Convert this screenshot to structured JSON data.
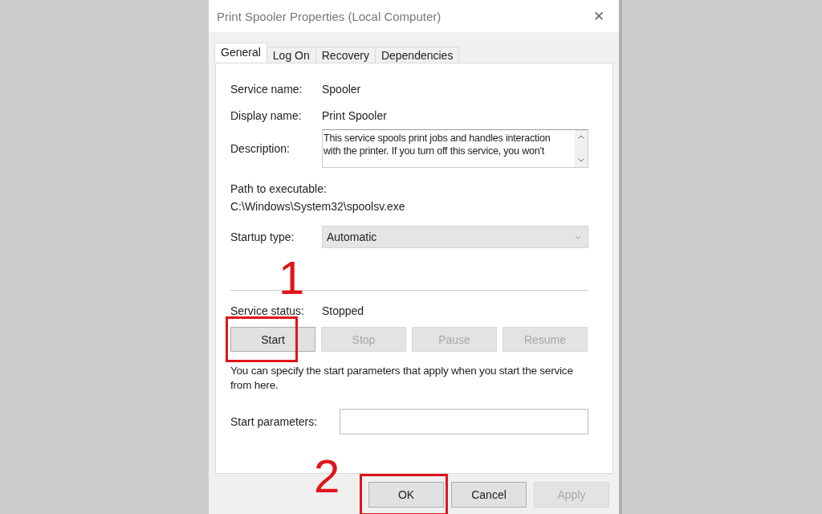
{
  "window": {
    "title": "Print Spooler Properties (Local Computer)",
    "close": "✕"
  },
  "tabs": [
    {
      "label": "General",
      "selected": true
    },
    {
      "label": "Log On",
      "selected": false
    },
    {
      "label": "Recovery",
      "selected": false
    },
    {
      "label": "Dependencies",
      "selected": false
    }
  ],
  "service_name": {
    "label": "Service name:",
    "value": "Spooler"
  },
  "display_name": {
    "label": "Display name:",
    "value": "Print Spooler"
  },
  "description": {
    "label": "Description:",
    "lines": [
      "This service spools print jobs and handles interaction",
      "with the printer.  If you turn off this service, you won't"
    ]
  },
  "path": {
    "label": "Path to executable:",
    "value": "C:\\Windows\\System32\\spoolsv.exe"
  },
  "startup_type": {
    "label": "Startup type:",
    "value": "Automatic"
  },
  "service_status": {
    "label": "Service status:",
    "value": "Stopped"
  },
  "service_buttons": [
    {
      "label": "Start",
      "disabled": false,
      "annotation": "1"
    },
    {
      "label": "Stop",
      "disabled": true
    },
    {
      "label": "Pause",
      "disabled": true
    },
    {
      "label": "Resume",
      "disabled": true
    }
  ],
  "hint": "You can specify the start parameters that apply when you start the service from here.",
  "start_parameters": {
    "label": "Start parameters:"
  },
  "dialog_buttons": [
    {
      "label": "OK",
      "disabled": false,
      "annotation": "2"
    },
    {
      "label": "Cancel",
      "disabled": false
    },
    {
      "label": "Apply",
      "disabled": true
    }
  ]
}
